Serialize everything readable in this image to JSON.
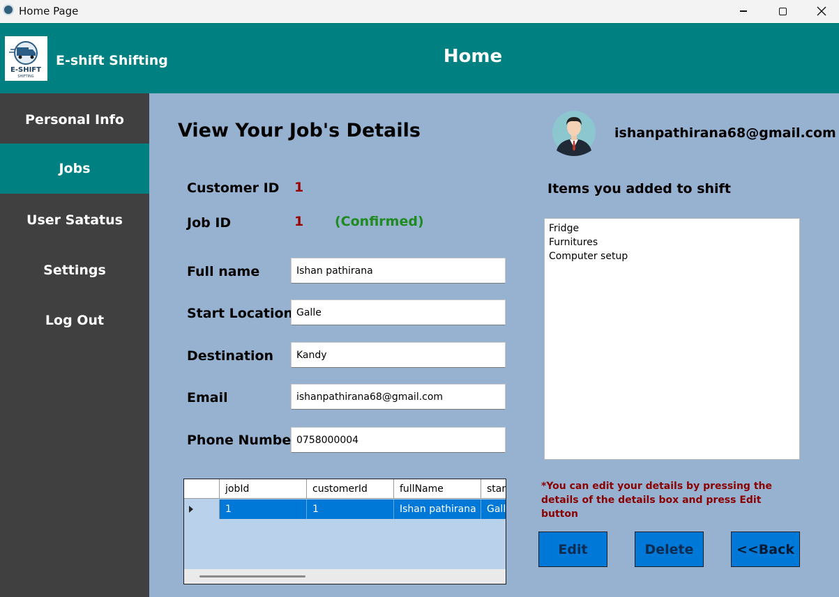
{
  "window": {
    "title": "Home Page"
  },
  "header": {
    "brand": "E-shift Shifting",
    "logo_text_top": "E-SHIFT",
    "logo_text_bottom": "SHIFTING",
    "page_title": "Home"
  },
  "sidebar": {
    "items": [
      {
        "label": "Personal Info",
        "active": false
      },
      {
        "label": "Jobs",
        "active": true
      },
      {
        "label": "User Satatus",
        "active": false
      },
      {
        "label": "Settings",
        "active": false
      },
      {
        "label": "Log Out",
        "active": false
      }
    ]
  },
  "main": {
    "section_title": "View Your Job's Details",
    "user_email": "ishanpathirana68@gmail.com",
    "customer_id_label": "Customer ID",
    "customer_id_value": "1",
    "job_id_label": "Job ID",
    "job_id_value": "1",
    "job_status": "(Confirmed)",
    "fields": {
      "full_name": {
        "label": "Full name",
        "value": "Ishan pathirana"
      },
      "start_location": {
        "label": "Start Location",
        "value": "Galle"
      },
      "destination": {
        "label": "Destination",
        "value": "Kandy"
      },
      "email": {
        "label": "Email",
        "value": "ishanpathirana68@gmail.com"
      },
      "phone": {
        "label": "Phone Number",
        "value": "0758000004"
      }
    },
    "items_title": "Items you added to shift",
    "items": [
      "Fridge",
      "Furnitures",
      "Computer setup"
    ],
    "note_line1": "*You can edit your details by pressing the",
    "note_line2": "details of the details box and press Edit button",
    "buttons": {
      "edit": "Edit",
      "delete": "Delete",
      "back": "<<Back"
    },
    "grid": {
      "columns": [
        "jobId",
        "customerId",
        "fullName",
        "startLocation"
      ],
      "rows": [
        [
          "1",
          "1",
          "Ishan pathirana",
          "Galle"
        ]
      ]
    }
  },
  "colors": {
    "header": "#008080",
    "sidebar": "#404040",
    "main_bg": "#97b2d1",
    "status_confirmed": "#1f8a1f",
    "id_value": "#9b0000",
    "button": "#0078d7"
  }
}
